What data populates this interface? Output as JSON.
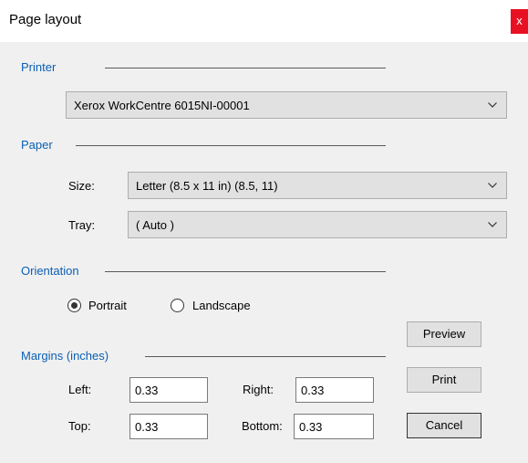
{
  "window": {
    "title": "Page layout",
    "close_glyph": "x"
  },
  "printer": {
    "section_label": "Printer",
    "selected": "Xerox WorkCentre 6015NI-00001"
  },
  "paper": {
    "section_label": "Paper",
    "size_label": "Size:",
    "size_value": "Letter (8.5 x 11 in) (8.5, 11)",
    "tray_label": "Tray:",
    "tray_value": "( Auto )"
  },
  "orientation": {
    "section_label": "Orientation",
    "portrait_label": "Portrait",
    "landscape_label": "Landscape",
    "selected": "Portrait"
  },
  "margins": {
    "section_label": "Margins (inches)",
    "left_label": "Left:",
    "left_value": "0.33",
    "right_label": "Right:",
    "right_value": "0.33",
    "top_label": "Top:",
    "top_value": "0.33",
    "bottom_label": "Bottom:",
    "bottom_value": "0.33"
  },
  "buttons": {
    "preview": "Preview",
    "print": "Print",
    "cancel": "Cancel"
  },
  "colors": {
    "section_label": "#0a5fb4",
    "close_button": "#e81123",
    "dialog_background": "#f0f0f0"
  },
  "icons": {
    "dropdown": "chevron-down-icon",
    "close": "close-icon"
  }
}
